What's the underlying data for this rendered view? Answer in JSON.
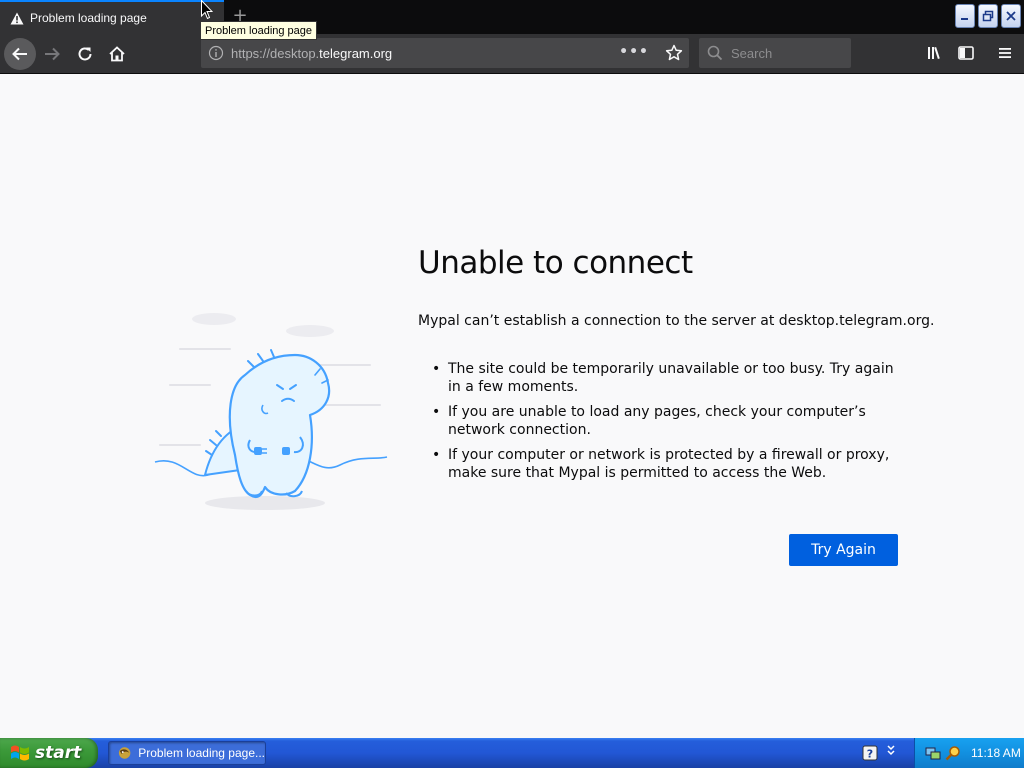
{
  "browser": {
    "tab": {
      "title": "Problem loading page",
      "icon": "warning-icon"
    },
    "tooltip": "Problem loading page",
    "url": {
      "prefix": "https://desktop.",
      "domain": "telegram.org"
    },
    "page_actions": "•••",
    "search": {
      "placeholder": "Search"
    }
  },
  "error_page": {
    "title": "Unable to connect",
    "description": "Mypal can’t establish a connection to the server at desktop.telegram.org.",
    "bullets": [
      "The site could be temporarily unavailable or too busy. Try again in a few moments.",
      "If you are unable to load any pages, check your computer’s network connection.",
      "If your computer or network is protected by a firewall or proxy, make sure that Mypal is permitted to access the Web."
    ],
    "try_again_label": "Try Again"
  },
  "taskbar": {
    "start_label": "start",
    "task_label": "Problem loading page...",
    "clock": "11:18 AM"
  },
  "colors": {
    "accent_blue": "#0060df",
    "tab_highlight": "#0a84ff",
    "toolbar_dark": "#323234",
    "page_bg": "#f9f9fa"
  }
}
